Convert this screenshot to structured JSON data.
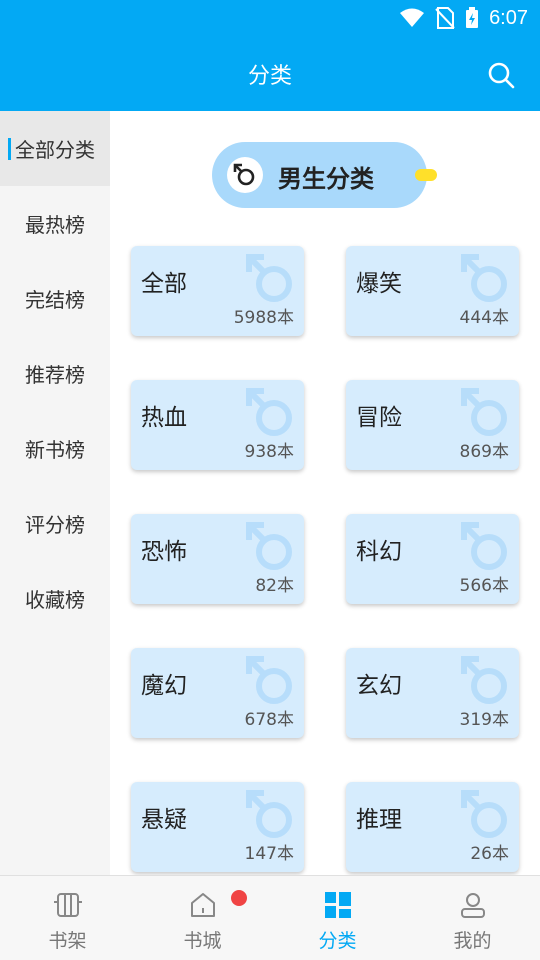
{
  "status": {
    "time": "6:07"
  },
  "header": {
    "title": "分类"
  },
  "sidebar": {
    "items": [
      {
        "label": "全部分类",
        "active": true
      },
      {
        "label": "最热榜"
      },
      {
        "label": "完结榜"
      },
      {
        "label": "推荐榜"
      },
      {
        "label": "新书榜"
      },
      {
        "label": "评分榜"
      },
      {
        "label": "收藏榜"
      }
    ]
  },
  "gender": {
    "label": "男生分类"
  },
  "categories": [
    {
      "name": "全部",
      "count": "5988本"
    },
    {
      "name": "爆笑",
      "count": "444本"
    },
    {
      "name": "热血",
      "count": "938本"
    },
    {
      "name": "冒险",
      "count": "869本"
    },
    {
      "name": "恐怖",
      "count": "82本"
    },
    {
      "name": "科幻",
      "count": "566本"
    },
    {
      "name": "魔幻",
      "count": "678本"
    },
    {
      "name": "玄幻",
      "count": "319本"
    },
    {
      "name": "悬疑",
      "count": "147本"
    },
    {
      "name": "推理",
      "count": "26本"
    }
  ],
  "nav": {
    "items": [
      {
        "label": "书架"
      },
      {
        "label": "书城"
      },
      {
        "label": "分类",
        "active": true
      },
      {
        "label": "我的"
      }
    ]
  },
  "colors": {
    "accent": "#03a9f4",
    "card": "#d6ecfd",
    "pill": "#a9d9fb",
    "badge": "#f04444"
  }
}
